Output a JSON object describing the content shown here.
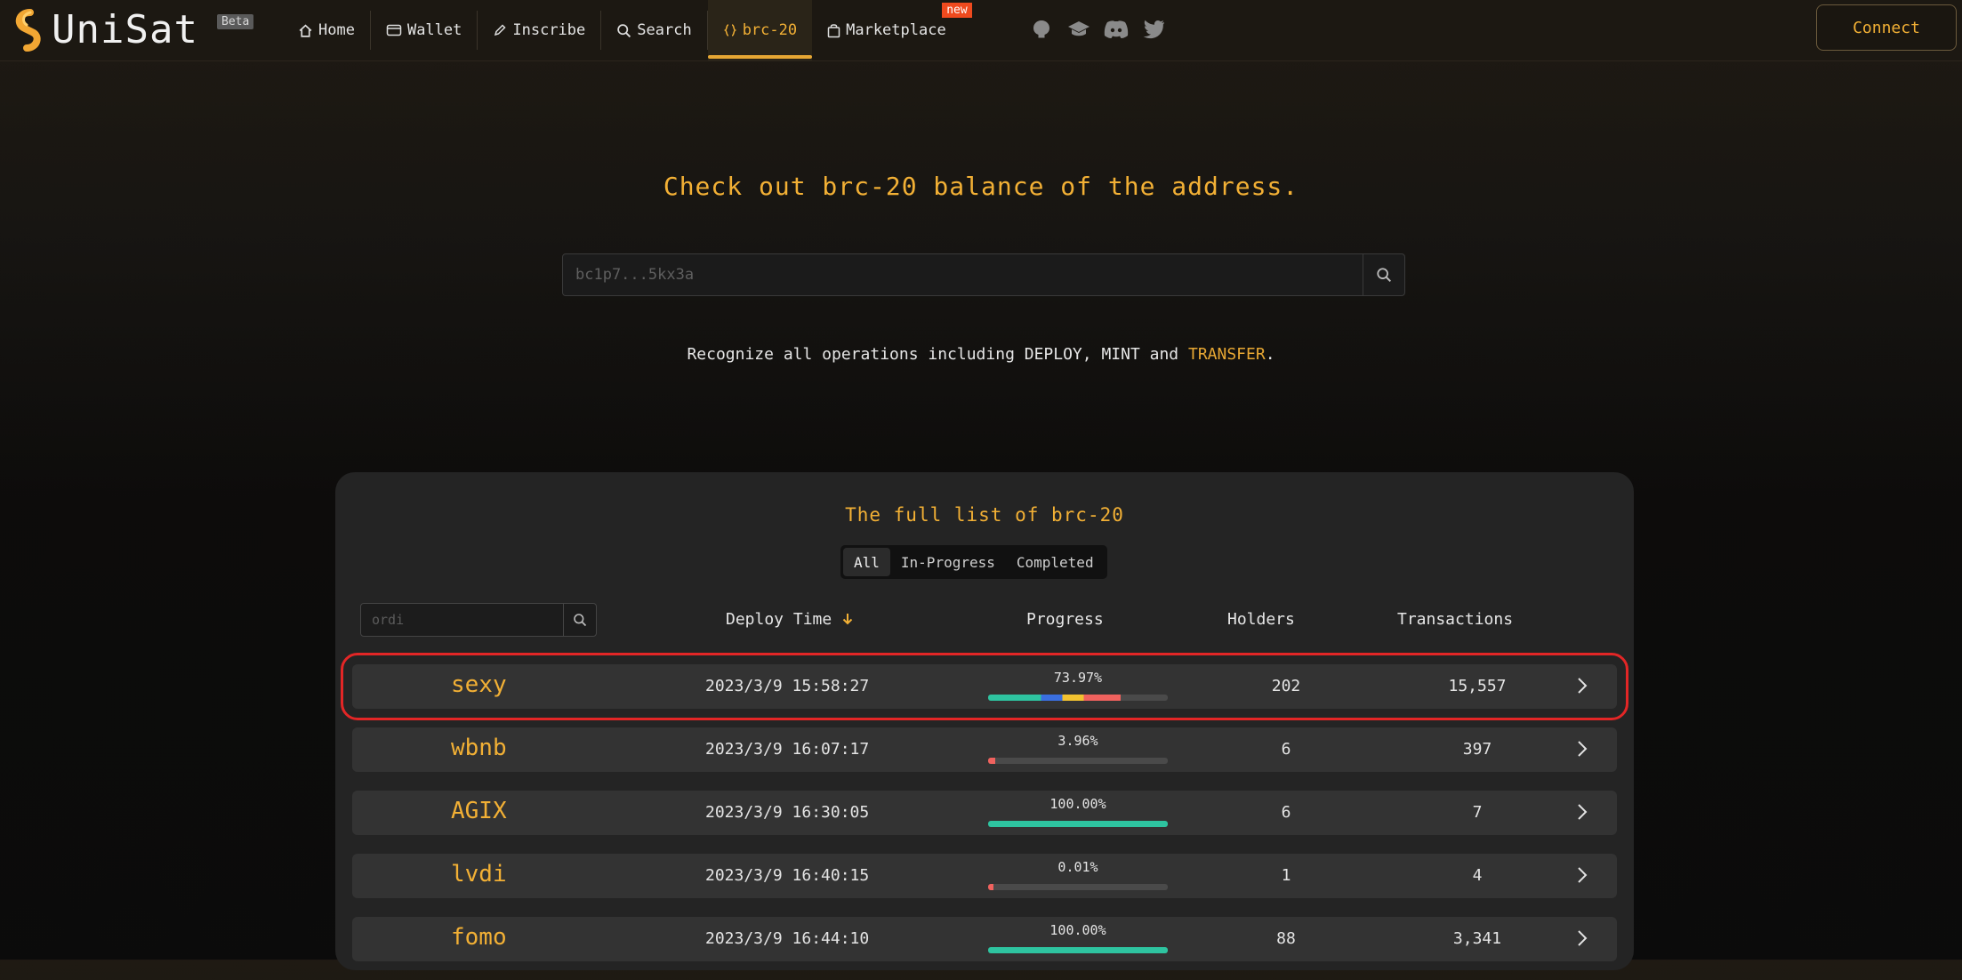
{
  "brand": {
    "name": "UniSat",
    "beta": "Beta"
  },
  "nav": {
    "items": [
      {
        "label": "Home",
        "icon": "home-icon"
      },
      {
        "label": "Wallet",
        "icon": "wallet-icon"
      },
      {
        "label": "Inscribe",
        "icon": "pencil-icon"
      },
      {
        "label": "Search",
        "icon": "search-icon"
      },
      {
        "label": "brc-20",
        "icon": "braces-icon",
        "active": true
      },
      {
        "label": "Marketplace",
        "icon": "bag-icon",
        "badge": "new"
      }
    ],
    "connect": "Connect"
  },
  "hero": {
    "title": "Check out brc-20 balance of the address.",
    "placeholder": "bc1p7...5kx3a",
    "recognize_prefix": "Recognize all operations including DEPLOY, MINT and ",
    "recognize_highlight": "TRANSFER",
    "recognize_suffix": "."
  },
  "panel": {
    "title": "The full list of brc-20",
    "filters": [
      "All",
      "In-Progress",
      "Completed"
    ],
    "active_filter": "All",
    "search_placeholder": "ordi",
    "columns": {
      "deploy_time": "Deploy Time",
      "progress": "Progress",
      "holders": "Holders",
      "transactions": "Transactions"
    }
  },
  "tokens": [
    {
      "ticker": "sexy",
      "deploy_time": "2023/3/9 15:58:27",
      "progress": "73.97%",
      "progress_value": 73.97,
      "holders": "202",
      "transactions": "15,557",
      "selected": true
    },
    {
      "ticker": "wbnb",
      "deploy_time": "2023/3/9 16:07:17",
      "progress": "3.96%",
      "progress_value": 3.96,
      "holders": "6",
      "transactions": "397"
    },
    {
      "ticker": "AGIX",
      "deploy_time": "2023/3/9 16:30:05",
      "progress": "100.00%",
      "progress_value": 100,
      "holders": "6",
      "transactions": "7"
    },
    {
      "ticker": "lvdi",
      "deploy_time": "2023/3/9 16:40:15",
      "progress": "0.01%",
      "progress_value": 0.01,
      "holders": "1",
      "transactions": "4"
    },
    {
      "ticker": "fomo",
      "deploy_time": "2023/3/9 16:44:10",
      "progress": "100.00%",
      "progress_value": 100,
      "holders": "88",
      "transactions": "3,341"
    }
  ],
  "colors": {
    "accent": "#f2b035",
    "progress_done": "#2ec4a0",
    "progress_low": "#f0625e",
    "selection": "#e32626"
  }
}
